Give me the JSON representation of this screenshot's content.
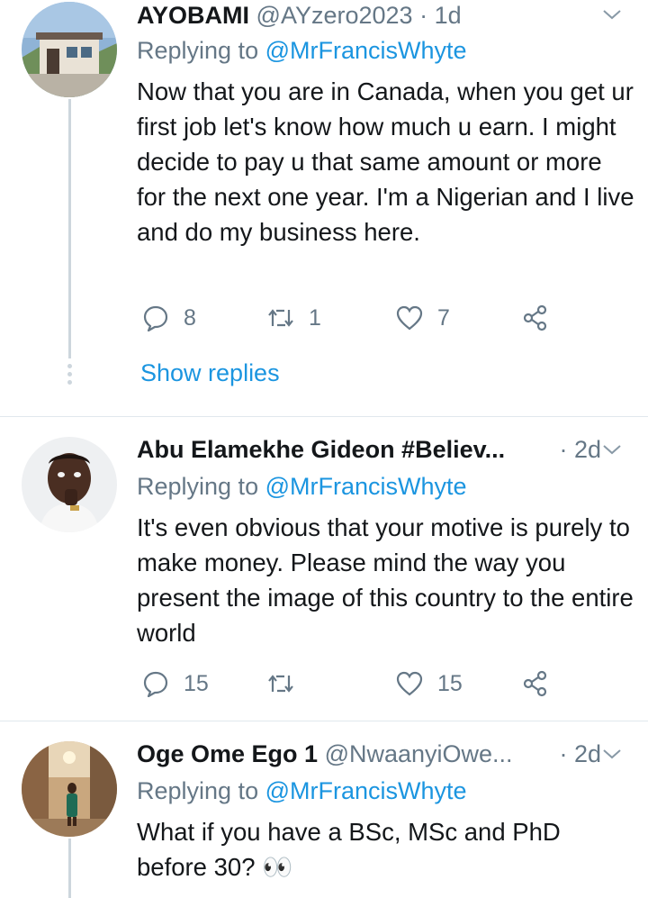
{
  "tweets": [
    {
      "name": "AYOBAMI",
      "handle": "@AYzero2023",
      "sep": " · ",
      "time": "1d",
      "replying_prefix": "Replying to ",
      "replying_to": "@MrFrancisWhyte",
      "text": "Now that you are in Canada, when you get ur first job let's know how much u earn. I might decide to pay u that same amount or more for the next one year. I'm a Nigerian and I live and do my business here.",
      "replies": "8",
      "retweets": "1",
      "likes": "7",
      "show_replies": "Show replies",
      "avatar_icon": "house-photo"
    },
    {
      "name": "Abu Elamekhe Gideon #Believ...",
      "handle": "",
      "sep": "· ",
      "time": "2d",
      "replying_prefix": "Replying to ",
      "replying_to": "@MrFrancisWhyte",
      "text": "It's even obvious that your motive is purely to make money. Please mind the way you present the image of this country to the entire world",
      "replies": "15",
      "retweets": "",
      "likes": "15",
      "avatar_icon": "person-photo"
    },
    {
      "name": "Oge Ome Ego 1",
      "handle": "@NwaanyiOwe...",
      "sep": " · ",
      "time": "2d",
      "replying_prefix": "Replying to ",
      "replying_to": "@MrFrancisWhyte",
      "text": "What if you have a BSc, MSc and PhD before 30? 👀",
      "avatar_icon": "person-photo"
    }
  ],
  "icons": {
    "reply": "reply-icon",
    "retweet": "retweet-icon",
    "like": "heart-icon",
    "share": "share-icon",
    "caret": "chevron-down-icon"
  },
  "colors": {
    "link": "#1b95e0",
    "secondary": "#657786",
    "text": "#14171a",
    "divider": "#e1e8ed"
  }
}
